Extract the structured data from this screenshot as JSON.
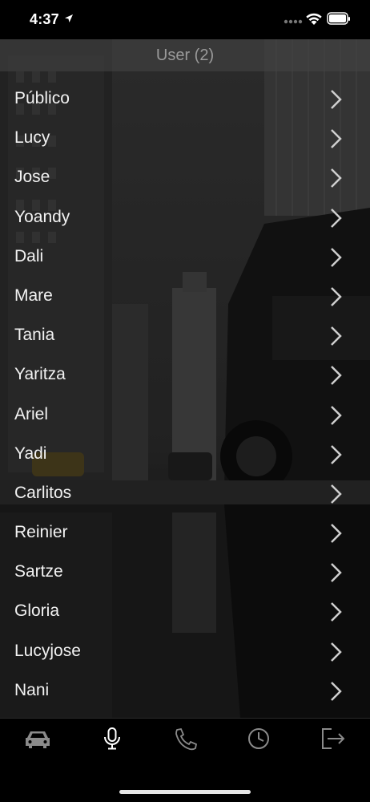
{
  "status": {
    "time": "4:37"
  },
  "header": {
    "title": "User (2)"
  },
  "users": [
    "Público",
    "Lucy",
    "Jose",
    "Yoandy",
    "Dali",
    "Mare",
    "Tania",
    "Yaritza",
    "Ariel",
    "Yadi",
    "Carlitos",
    "Reinier",
    "Sartze",
    "Gloria",
    "Lucyjose",
    "Nani"
  ],
  "tabs": [
    {
      "name": "taxi-icon"
    },
    {
      "name": "microphone-icon"
    },
    {
      "name": "phone-icon"
    },
    {
      "name": "clock-icon"
    },
    {
      "name": "logout-icon"
    }
  ],
  "colors": {
    "active_tab": "#ffffff",
    "inactive_tab": "#8a8a8a",
    "chevron": "#cfcfcf"
  }
}
